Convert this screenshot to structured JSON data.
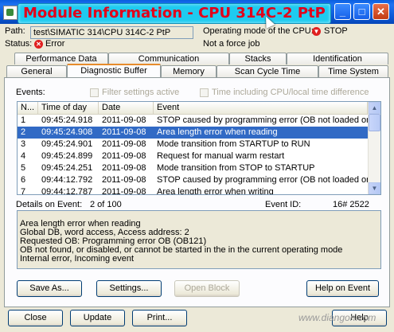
{
  "window": {
    "title": "Module Information - CPU 314C-2 PtP",
    "minimize_glyph": "_",
    "maximize_glyph": "□",
    "close_glyph": "✕"
  },
  "info": {
    "path_label": "Path:",
    "path_value": "test\\SIMATIC 314\\CPU 314C-2 PtP",
    "opmode_label": "Operating mode of the CPU:",
    "opmode_value": "STOP",
    "status_label": "Status:",
    "status_value": "Error",
    "force_value": "Not a force job"
  },
  "tabs": {
    "row_back": [
      "Performance Data",
      "Communication",
      "Stacks",
      "Identification"
    ],
    "row_front": [
      "General",
      "Diagnostic Buffer",
      "Memory",
      "Scan Cycle Time",
      "Time System"
    ],
    "active": "Diagnostic Buffer"
  },
  "events_section": {
    "label": "Events:",
    "filter_label": "Filter settings active",
    "time_label": "Time including CPU/local time difference"
  },
  "events_table": {
    "columns": [
      "N...",
      "Time of day",
      "Date",
      "Event"
    ],
    "rows": [
      {
        "n": "1",
        "time": "09:45:24.918",
        "date": "2011-09-08",
        "event": "STOP caused by programming error (OB not loaded or not..."
      },
      {
        "n": "2",
        "time": "09:45:24.908",
        "date": "2011-09-08",
        "event": "Area length error when reading"
      },
      {
        "n": "3",
        "time": "09:45:24.901",
        "date": "2011-09-08",
        "event": "Mode transition from STARTUP to RUN"
      },
      {
        "n": "4",
        "time": "09:45:24.899",
        "date": "2011-09-08",
        "event": "Request for manual warm restart"
      },
      {
        "n": "5",
        "time": "09:45:24.251",
        "date": "2011-09-08",
        "event": "Mode transition from STOP to STARTUP"
      },
      {
        "n": "6",
        "time": "09:44:12.792",
        "date": "2011-09-08",
        "event": "STOP caused by programming error (OB not loaded or not..."
      },
      {
        "n": "7",
        "time": "09:44:12.787",
        "date": "2011-09-08",
        "event": "Area length error when writing"
      }
    ],
    "selected_index": 1
  },
  "details": {
    "label": "Details on Event:",
    "count": "2 of 100",
    "event_id_label": "Event ID:",
    "event_id_value": "16# 2522",
    "lines": [
      "Area length error when reading",
      "Global DB, word access, Access address:        2",
      "Requested OB: Programming error OB (OB121)",
      "OB not found, or disabled, or cannot be started in the in the current operating mode",
      "Internal error, Incoming event"
    ]
  },
  "buttons": {
    "save_as": "Save As...",
    "settings": "Settings...",
    "open_block": "Open Block",
    "help_on_event": "Help on Event",
    "close": "Close",
    "update": "Update",
    "print": "Print...",
    "help": "Help"
  },
  "watermark": "www.diangon.com"
}
